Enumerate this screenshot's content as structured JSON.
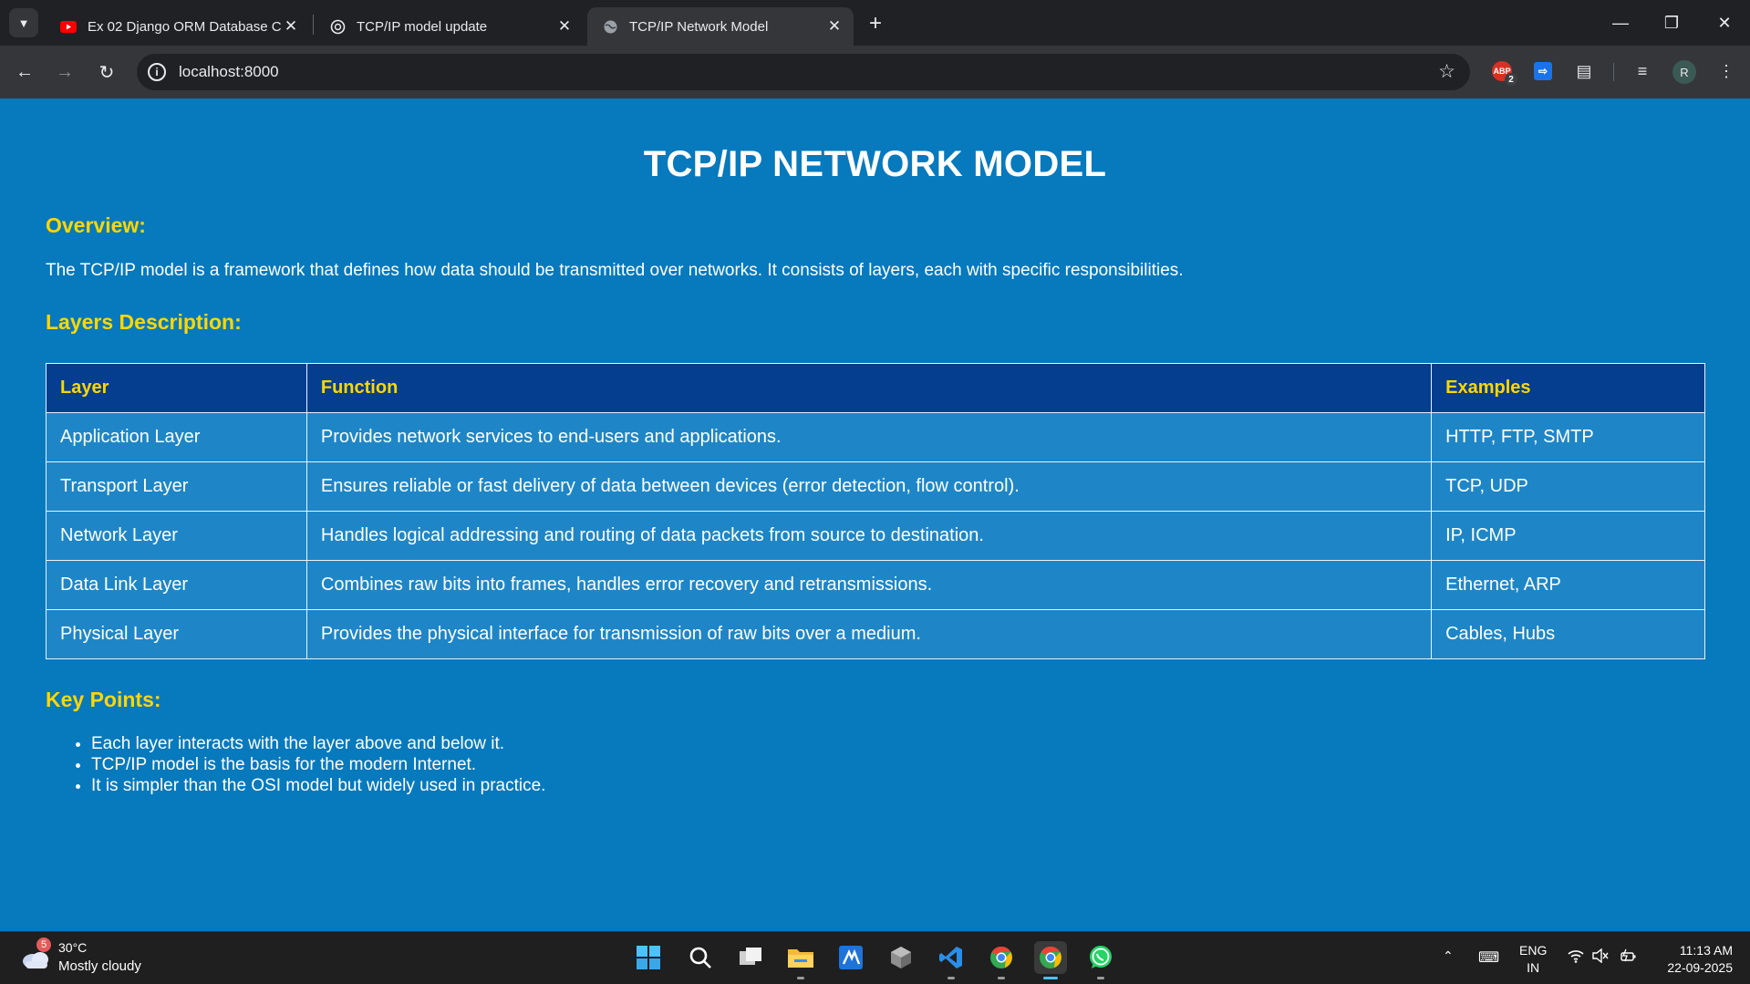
{
  "browser": {
    "tabs": [
      {
        "title": "Ex 02 Django ORM Database Cr",
        "favicon": "youtube-icon"
      },
      {
        "title": "TCP/IP model update",
        "favicon": "chatgpt-icon"
      },
      {
        "title": "TCP/IP Network Model",
        "favicon": "globe-icon",
        "active": true
      }
    ],
    "address": "localhost:8000",
    "extension_badge": "2",
    "extension_label": "ABP",
    "profile_initial": "R"
  },
  "page": {
    "title": "TCP/IP NETWORK MODEL",
    "overview_heading": "Overview:",
    "overview_text": "The TCP/IP model is a framework that defines how data should be transmitted over networks. It consists of layers, each with specific responsibilities.",
    "layers_heading": "Layers Description:",
    "table": {
      "headers": [
        "Layer",
        "Function",
        "Examples"
      ],
      "rows": [
        [
          "Application Layer",
          "Provides network services to end-users and applications.",
          "HTTP, FTP, SMTP"
        ],
        [
          "Transport Layer",
          "Ensures reliable or fast delivery of data between devices (error detection, flow control).",
          "TCP, UDP"
        ],
        [
          "Network Layer",
          "Handles logical addressing and routing of data packets from source to destination.",
          "IP, ICMP"
        ],
        [
          "Data Link Layer",
          "Combines raw bits into frames, handles error recovery and retransmissions.",
          "Ethernet, ARP"
        ],
        [
          "Physical Layer",
          "Provides the physical interface for transmission of raw bits over a medium.",
          "Cables, Hubs"
        ]
      ]
    },
    "key_points_heading": "Key Points:",
    "key_points": [
      "Each layer interacts with the layer above and below it.",
      "TCP/IP model is the basis for the modern Internet.",
      "It is simpler than the OSI model but widely used in practice."
    ],
    "colors": {
      "background": "#0779bd",
      "heading": "#ffd700",
      "table_header": "#053d8f",
      "table_cell": "#1e86c7"
    }
  },
  "taskbar": {
    "weather_badge": "5",
    "temperature": "30°C",
    "condition": "Mostly cloudy",
    "language": "ENG",
    "region": "IN",
    "time": "11:13 AM",
    "date": "22-09-2025"
  }
}
